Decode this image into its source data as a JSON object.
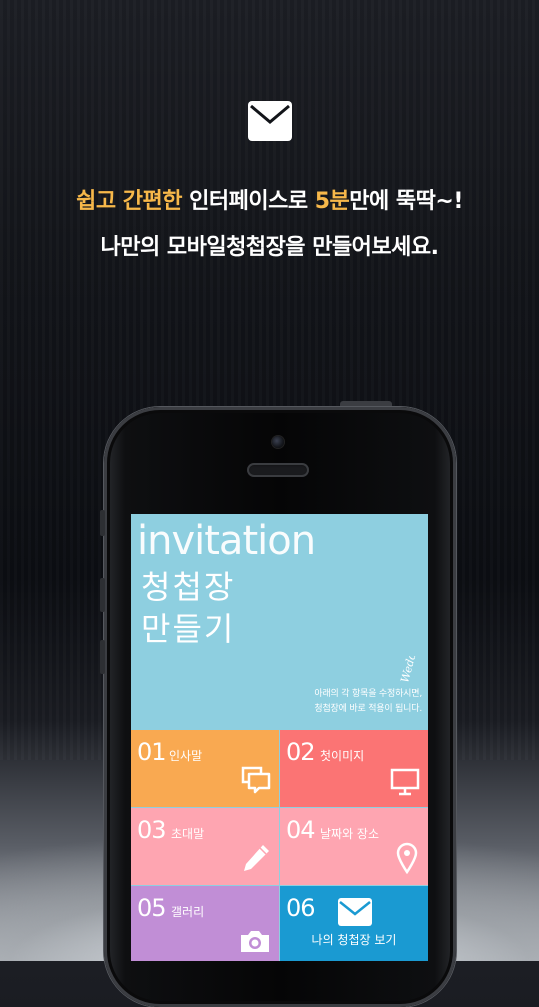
{
  "headline": {
    "line1_part1": "쉽고 간편한",
    "line1_part2": " 인터페이스로 ",
    "line1_part3": "5분",
    "line1_part4": "만에 뚝딱~!",
    "line2": "나만의 모바일청첩장을 만들어보세요."
  },
  "screen": {
    "title_en": "invitation",
    "title_ko_1": "청첩장",
    "title_ko_2": "만들기",
    "logo_text": "Wedding",
    "hint_line1": "아래의 각 항목을 수정하시면,",
    "hint_line2": "청첩장에 바로 적용이 됩니다.",
    "tiles": [
      {
        "num": "01",
        "label": "인사말",
        "icon": "chat-bubbles-icon",
        "color": "#f9a951"
      },
      {
        "num": "02",
        "label": "첫이미지",
        "icon": "monitor-icon",
        "color": "#fb7474"
      },
      {
        "num": "03",
        "label": "초대말",
        "icon": "pencil-icon",
        "color": "#fea5b1"
      },
      {
        "num": "04",
        "label": "날짜와 장소",
        "icon": "location-pin-icon",
        "color": "#fea5b1"
      },
      {
        "num": "05",
        "label": "갤러리",
        "icon": "camera-icon",
        "color": "#c18ed6"
      },
      {
        "num": "06",
        "label": "나의 청첩장 보기",
        "icon": "envelope-icon",
        "color": "#1a9ad2"
      }
    ]
  },
  "colors": {
    "accent": "#f7b84a",
    "hero": "#8ecfe0"
  }
}
